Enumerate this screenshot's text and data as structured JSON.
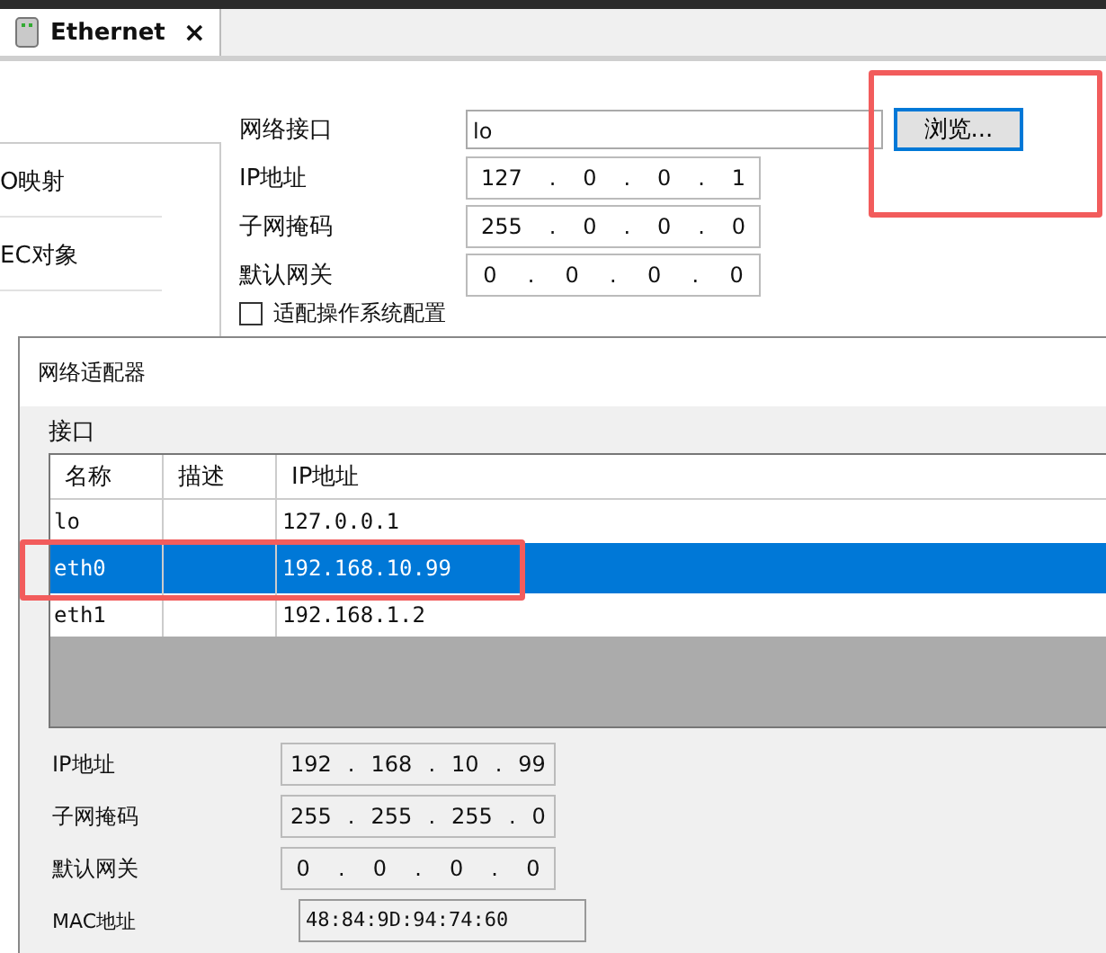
{
  "tab": {
    "title": "Ethernet",
    "close": "×",
    "selected": true
  },
  "sidebar": {
    "items": [
      {
        "label": "O映射"
      },
      {
        "label": "EC对象"
      }
    ]
  },
  "form": {
    "separator": ".",
    "interface": {
      "label": "网络接口",
      "value": "lo"
    },
    "browse_button": "浏览...",
    "fields": [
      {
        "label": "IP地址",
        "octets": [
          "127",
          "0",
          "0",
          "1"
        ]
      },
      {
        "label": "子网掩码",
        "octets": [
          "255",
          "0",
          "0",
          "0"
        ]
      },
      {
        "label": "默认网关",
        "octets": [
          "0",
          "0",
          "0",
          "0"
        ]
      }
    ],
    "adapt_checkbox": {
      "label": "适配操作系统配置",
      "checked": false
    }
  },
  "dialog": {
    "title": "网络适配器",
    "group_label": "接口",
    "separator": ".",
    "table": {
      "columns": [
        "名称",
        "描述",
        "IP地址"
      ],
      "rows": [
        {
          "name": "lo",
          "ip": "127.0.0.1",
          "selected": false
        },
        {
          "name": "eth0",
          "ip": "192.168.10.99",
          "selected": true
        },
        {
          "name": "eth1",
          "ip": "192.168.1.2",
          "selected": false
        }
      ]
    },
    "fields": [
      {
        "label": "IP地址",
        "octets": [
          "192",
          "168",
          "10",
          "99"
        ]
      },
      {
        "label": "子网掩码",
        "octets": [
          "255",
          "255",
          "255",
          "0"
        ]
      },
      {
        "label": "默认网关",
        "octets": [
          "0",
          "0",
          "0",
          "0"
        ]
      }
    ],
    "mac": {
      "label": "MAC地址",
      "value": "48:84:9D:94:74:60"
    }
  }
}
